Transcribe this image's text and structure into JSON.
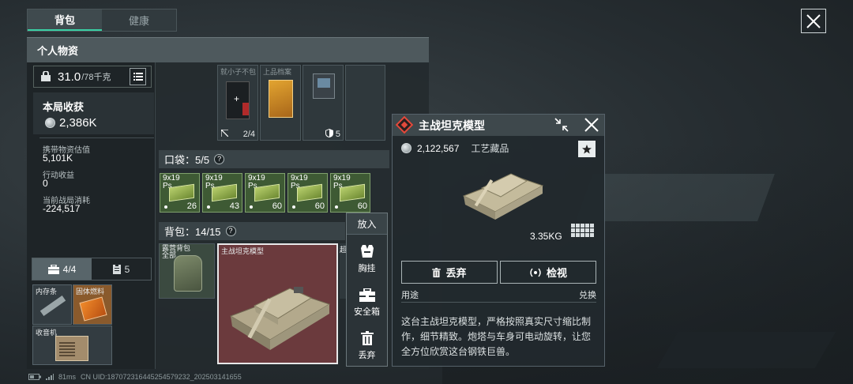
{
  "tabs": [
    {
      "label": "背包",
      "active": true
    },
    {
      "label": "健康",
      "active": false
    }
  ],
  "panel": {
    "title": "个人物资"
  },
  "weight": {
    "current": "31.0",
    "capacity": "/78千克"
  },
  "round": {
    "title": "本局收获",
    "total": "2,386K",
    "stats": [
      {
        "label": "携带物资估值",
        "value": "5,101K"
      },
      {
        "label": "行动收益",
        "value": "0"
      },
      {
        "label": "当前战局消耗",
        "value": "-224,517"
      }
    ]
  },
  "bottom_tabs": [
    {
      "label": "4/4",
      "icon": "toolbox-icon",
      "active": true
    },
    {
      "label": "5",
      "icon": "clipboard-icon",
      "active": false
    }
  ],
  "slots": [
    {
      "label": "内存条"
    },
    {
      "label": "固体燃料"
    },
    {
      "label": "收音机"
    }
  ],
  "top_items": {
    "labels": [
      "就小子不包",
      "上品档案"
    ],
    "counts": [
      "2/4",
      "5"
    ]
  },
  "pocket": {
    "label": "口袋：5/5",
    "help": "?"
  },
  "ammo": [
    {
      "label": "9x19\nPs",
      "count": "26"
    },
    {
      "label": "9x19\nPs",
      "count": "43"
    },
    {
      "label": "9x19\nPs",
      "count": "60"
    },
    {
      "label": "9x19\nPs",
      "count": "60"
    },
    {
      "label": "9x19\nPs",
      "count": "60"
    }
  ],
  "backpack": {
    "label": "背包：14/15",
    "help": "?"
  },
  "backpack_items": [
    {
      "label": "露营背包\n全部"
    },
    {
      "label": "主战坦克模型"
    },
    {
      "label": "超"
    }
  ],
  "context_menu": {
    "header": "放入",
    "items": [
      {
        "label": "胸挂",
        "icon": "vest-icon"
      },
      {
        "label": "安全箱",
        "icon": "safebox-icon"
      },
      {
        "label": "丢弃",
        "icon": "trash-icon"
      }
    ]
  },
  "detail": {
    "title": "主战坦克模型",
    "price": "2,122,567",
    "category": "工艺藏品",
    "weight": "3.35KG",
    "discard_label": "丢弃",
    "inspect_label": "检视",
    "usage_label": "用途",
    "exchange_label": "兑换",
    "description": "这台主战坦克模型，严格按照真实尺寸缩比制作，细节精致。炮塔与车身可电动旋转，让您全方位欣赏这台钢铁巨兽。"
  },
  "status_bar": {
    "ping": "81ms",
    "uid": "CN UID:187072316445254579232_202503141655"
  },
  "colors": {
    "accent": "#3ad0a5",
    "rarity_red": "#e24a3c",
    "ammo_green": "#3e5a34",
    "selected_item_bg": "#6b3a3d"
  }
}
